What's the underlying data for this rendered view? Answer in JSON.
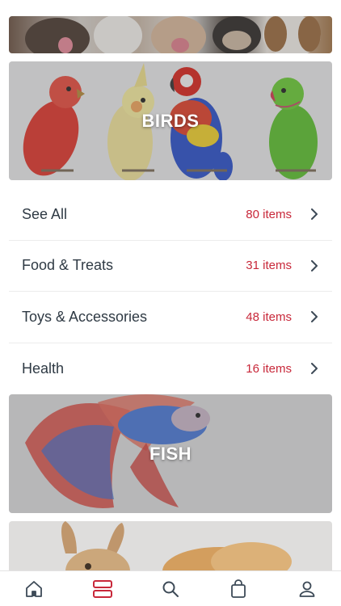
{
  "categories": {
    "birds_title": "BIRDS",
    "fish_title": "FISH"
  },
  "birds_list": [
    {
      "label": "See All",
      "count": "80 items"
    },
    {
      "label": "Food & Treats",
      "count": "31 items"
    },
    {
      "label": "Toys & Accessories",
      "count": "48 items"
    },
    {
      "label": "Health",
      "count": "16 items"
    }
  ],
  "tabbar": {
    "active": "categories",
    "items": [
      "home-icon",
      "categories-icon",
      "search-icon",
      "bag-icon",
      "account-icon"
    ]
  },
  "colors": {
    "accent": "#c8283a",
    "text": "#2f3a44",
    "icon": "#3d4a57"
  }
}
